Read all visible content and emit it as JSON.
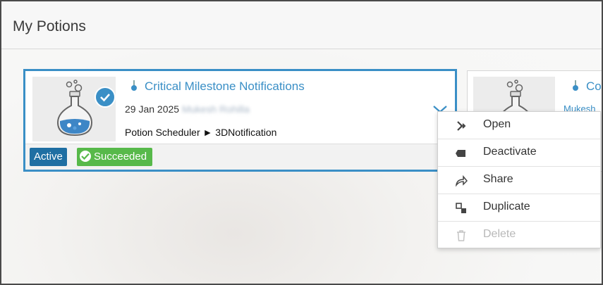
{
  "header": {
    "title": "My Potions"
  },
  "card": {
    "title": "Critical Milestone Notifications",
    "date": "29 Jan 2025",
    "owner": "Mukesh Rohilla",
    "path_app": "Potion Scheduler",
    "path_separator": "►",
    "path_target": "3DNotification",
    "status_active": "Active",
    "status_succeeded": "Succeeded"
  },
  "card2": {
    "title_partial": "Co",
    "user_partial": "Mukesh"
  },
  "menu": {
    "items": [
      {
        "label": "Open",
        "icon": "open-arrow-icon",
        "enabled": true
      },
      {
        "label": "Deactivate",
        "icon": "deactivate-tag-icon",
        "enabled": true
      },
      {
        "label": "Share",
        "icon": "share-icon",
        "enabled": true
      },
      {
        "label": "Duplicate",
        "icon": "duplicate-icon",
        "enabled": true
      },
      {
        "label": "Delete",
        "icon": "trash-icon",
        "enabled": false
      }
    ]
  },
  "colors": {
    "accent": "#3a8fc6",
    "active_badge": "#1f6fa3",
    "succeeded_badge": "#57b94a"
  }
}
